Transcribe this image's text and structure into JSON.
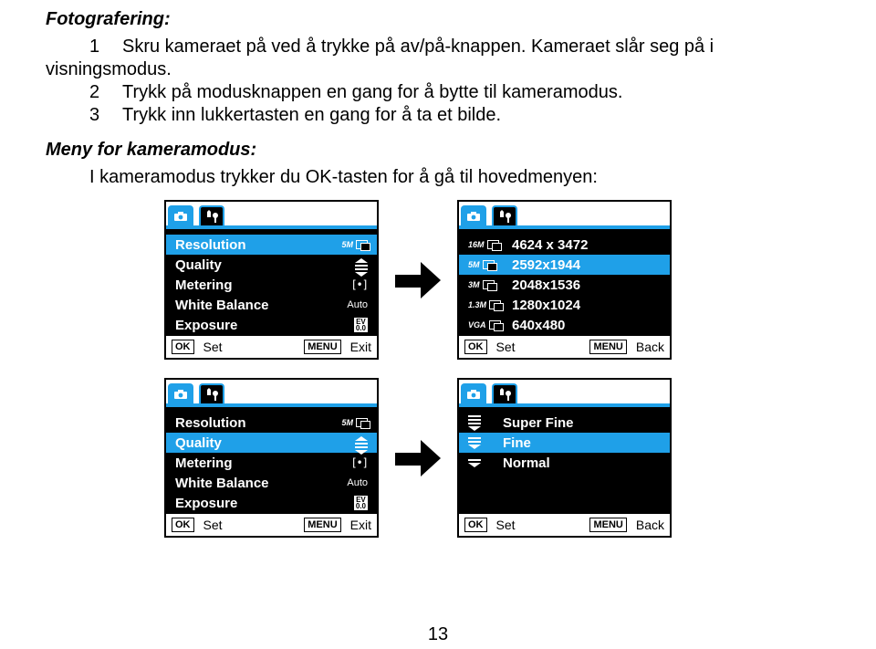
{
  "heading": "Fotografering:",
  "steps": {
    "s1_num": "1",
    "s1a": "Skru kameraet på ved å trykke på av/på-knappen. Kameraet slår seg på i",
    "s1b": "visningsmodus.",
    "s2_num": "2",
    "s2": "Trykk på modusknappen en gang for å bytte til kameramodus.",
    "s3_num": "3",
    "s3": "Trykk inn lukkertasten en gang for å ta et bilde."
  },
  "section2_title": "Meny for kameramodus:",
  "section2_text": "I kameramodus trykker du OK-tasten for å gå til hovedmenyen:",
  "panel_settings": {
    "items": [
      {
        "label": "Resolution",
        "value_kind": "res",
        "value": "5M",
        "selected": true
      },
      {
        "label": "Quality",
        "value_kind": "stack3"
      },
      {
        "label": "Metering",
        "value_kind": "bracket"
      },
      {
        "label": "White Balance",
        "value_kind": "text",
        "value": "Auto"
      },
      {
        "label": "Exposure",
        "value_kind": "ev",
        "value": "EV\n0.0"
      }
    ],
    "footer_ok": "OK",
    "footer_set": "Set",
    "footer_menu": "MENU",
    "footer_exit": "Exit"
  },
  "panel_resolution": {
    "items": [
      {
        "icon": "16M",
        "label": "4624 x 3472"
      },
      {
        "icon": "5M",
        "label": "2592x1944",
        "selected": true
      },
      {
        "icon": "3M",
        "label": "2048x1536"
      },
      {
        "icon": "1.3M",
        "label": "1280x1024"
      },
      {
        "icon": "VGA",
        "label": "640x480"
      }
    ],
    "footer_ok": "OK",
    "footer_set": "Set",
    "footer_menu": "MENU",
    "footer_back": "Back"
  },
  "panel_settings_q": {
    "items": [
      {
        "label": "Resolution",
        "value_kind": "res",
        "value": "5M"
      },
      {
        "label": "Quality",
        "value_kind": "stack3",
        "selected": true
      },
      {
        "label": "Metering",
        "value_kind": "bracket"
      },
      {
        "label": "White Balance",
        "value_kind": "text",
        "value": "Auto"
      },
      {
        "label": "Exposure",
        "value_kind": "ev",
        "value": "EV\n0.0"
      }
    ],
    "footer_ok": "OK",
    "footer_set": "Set",
    "footer_menu": "MENU",
    "footer_exit": "Exit"
  },
  "panel_quality": {
    "items": [
      {
        "icon_kind": "stack4",
        "label": "Super Fine"
      },
      {
        "icon_kind": "stack3",
        "label": "Fine",
        "selected": true
      },
      {
        "icon_kind": "stack2",
        "label": "Normal"
      }
    ],
    "footer_ok": "OK",
    "footer_set": "Set",
    "footer_menu": "MENU",
    "footer_back": "Back"
  },
  "pagenum": "13"
}
